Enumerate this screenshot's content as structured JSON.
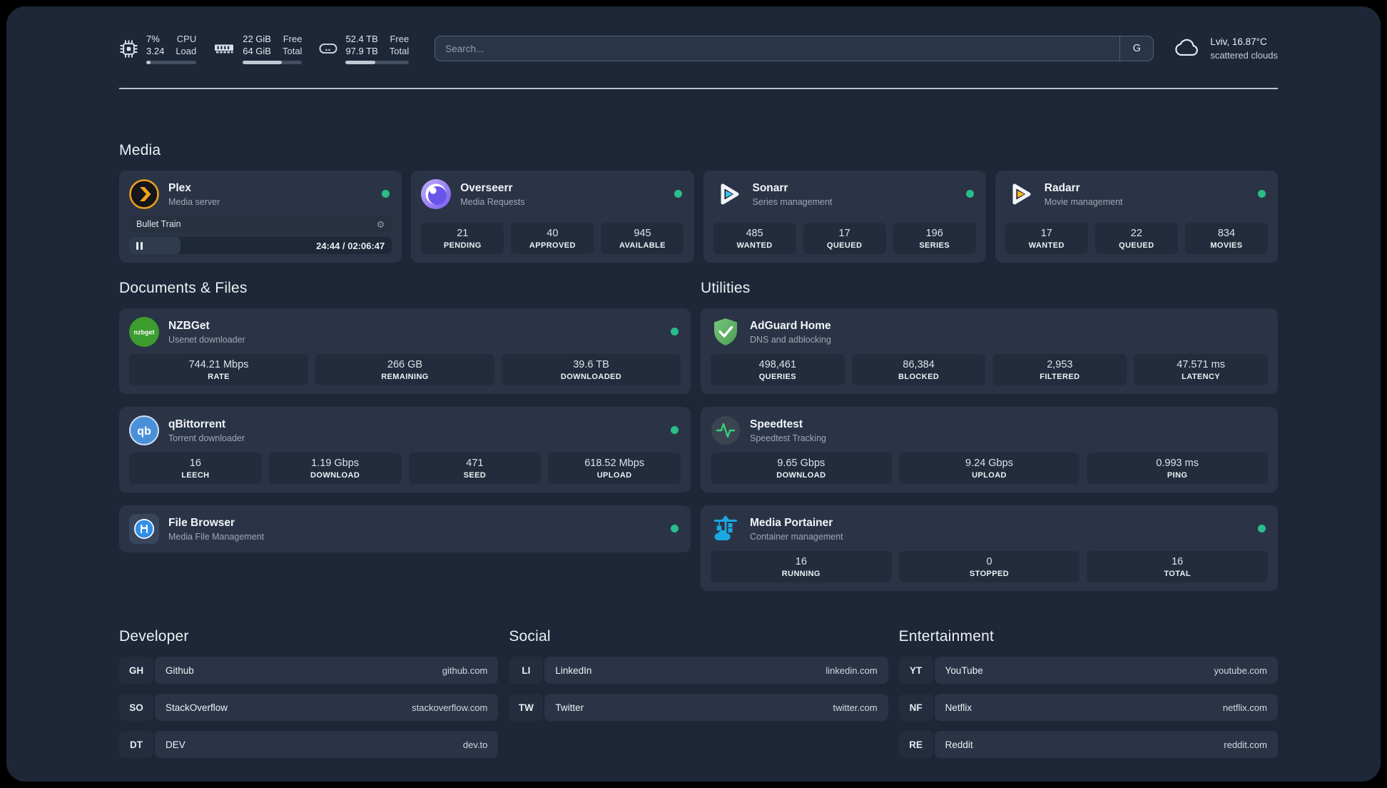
{
  "header": {
    "system": {
      "cpu": {
        "value1": "7%",
        "value2": "3.24",
        "label1": "CPU",
        "label2": "Load",
        "percent": 8
      },
      "memory": {
        "value1": "22 GiB",
        "value2": "64 GiB",
        "label1": "Free",
        "label2": "Total",
        "percent": 66
      },
      "disk": {
        "value1": "52.4 TB",
        "value2": "97.9 TB",
        "label1": "Free",
        "label2": "Total",
        "percent": 47
      }
    },
    "search": {
      "placeholder": "Search...",
      "button_label": "G"
    },
    "weather": {
      "location": "Lviv, 16.87°C",
      "condition": "scattered clouds"
    }
  },
  "colors": {
    "background": "#1d2737",
    "card": "#2a3446",
    "stat_box": "#222c3c",
    "status_online": "#2abd8a"
  },
  "sections": {
    "media": {
      "title": "Media",
      "cards": [
        {
          "title": "Plex",
          "subtitle": "Media server",
          "online": true,
          "now_playing": {
            "title": "Bullet Train",
            "time": "24:44 / 02:06:47",
            "progress_percent": 19.5
          }
        },
        {
          "title": "Overseerr",
          "subtitle": "Media Requests",
          "online": true,
          "stats": [
            {
              "value": "21",
              "label": "PENDING"
            },
            {
              "value": "40",
              "label": "APPROVED"
            },
            {
              "value": "945",
              "label": "AVAILABLE"
            }
          ]
        },
        {
          "title": "Sonarr",
          "subtitle": "Series management",
          "online": true,
          "stats": [
            {
              "value": "485",
              "label": "WANTED"
            },
            {
              "value": "17",
              "label": "QUEUED"
            },
            {
              "value": "196",
              "label": "SERIES"
            }
          ]
        },
        {
          "title": "Radarr",
          "subtitle": "Movie management",
          "online": true,
          "stats": [
            {
              "value": "17",
              "label": "WANTED"
            },
            {
              "value": "22",
              "label": "QUEUED"
            },
            {
              "value": "834",
              "label": "MOVIES"
            }
          ]
        }
      ]
    },
    "documents": {
      "title": "Documents & Files",
      "cards": [
        {
          "title": "NZBGet",
          "subtitle": "Usenet downloader",
          "online": true,
          "stats": [
            {
              "value": "744.21 Mbps",
              "label": "RATE"
            },
            {
              "value": "266 GB",
              "label": "REMAINING"
            },
            {
              "value": "39.6 TB",
              "label": "DOWNLOADED"
            }
          ]
        },
        {
          "title": "qBittorrent",
          "subtitle": "Torrent downloader",
          "online": true,
          "stats": [
            {
              "value": "16",
              "label": "LEECH"
            },
            {
              "value": "1.19 Gbps",
              "label": "DOWNLOAD"
            },
            {
              "value": "471",
              "label": "SEED"
            },
            {
              "value": "618.52 Mbps",
              "label": "UPLOAD"
            }
          ]
        },
        {
          "title": "File Browser",
          "subtitle": "Media File Management",
          "online": true
        }
      ]
    },
    "utilities": {
      "title": "Utilities",
      "cards": [
        {
          "title": "AdGuard Home",
          "subtitle": "DNS and adblocking",
          "online": false,
          "stats": [
            {
              "value": "498,461",
              "label": "QUERIES"
            },
            {
              "value": "86,384",
              "label": "BLOCKED"
            },
            {
              "value": "2,953",
              "label": "FILTERED"
            },
            {
              "value": "47.571 ms",
              "label": "LATENCY"
            }
          ]
        },
        {
          "title": "Speedtest",
          "subtitle": "Speedtest Tracking",
          "online": false,
          "stats": [
            {
              "value": "9.65 Gbps",
              "label": "DOWNLOAD"
            },
            {
              "value": "9.24 Gbps",
              "label": "UPLOAD"
            },
            {
              "value": "0.993 ms",
              "label": "PING"
            }
          ]
        },
        {
          "title": "Media Portainer",
          "subtitle": "Container management",
          "online": true,
          "stats": [
            {
              "value": "16",
              "label": "RUNNING"
            },
            {
              "value": "0",
              "label": "STOPPED"
            },
            {
              "value": "16",
              "label": "TOTAL"
            }
          ]
        }
      ]
    },
    "developer": {
      "title": "Developer",
      "links": [
        {
          "abbr": "GH",
          "name": "Github",
          "url": "github.com"
        },
        {
          "abbr": "SO",
          "name": "StackOverflow",
          "url": "stackoverflow.com"
        },
        {
          "abbr": "DT",
          "name": "DEV",
          "url": "dev.to"
        }
      ]
    },
    "social": {
      "title": "Social",
      "links": [
        {
          "abbr": "LI",
          "name": "LinkedIn",
          "url": "linkedin.com"
        },
        {
          "abbr": "TW",
          "name": "Twitter",
          "url": "twitter.com"
        }
      ]
    },
    "entertainment": {
      "title": "Entertainment",
      "links": [
        {
          "abbr": "YT",
          "name": "YouTube",
          "url": "youtube.com"
        },
        {
          "abbr": "NF",
          "name": "Netflix",
          "url": "netflix.com"
        },
        {
          "abbr": "RE",
          "name": "Reddit",
          "url": "reddit.com"
        }
      ]
    }
  }
}
